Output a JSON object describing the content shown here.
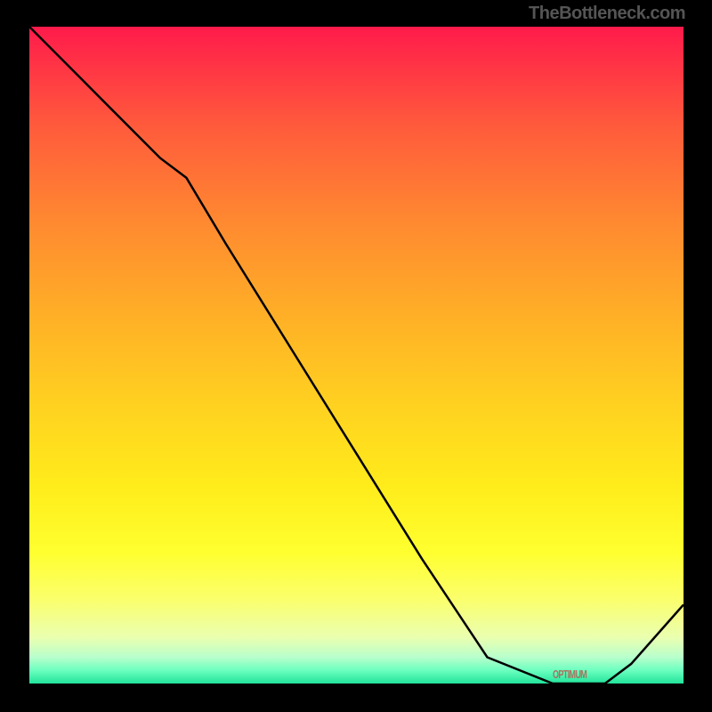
{
  "attribution": "TheBottleneck.com",
  "gradient": {
    "top": "#ff1a4b",
    "bottom": "#22e39a"
  },
  "bottom_marker_label": "OPTIMUM",
  "chart_data": {
    "type": "line",
    "title": "",
    "xlabel": "",
    "ylabel": "",
    "x": [
      0.0,
      0.04,
      0.08,
      0.12,
      0.16,
      0.2,
      0.24,
      0.3,
      0.4,
      0.5,
      0.6,
      0.7,
      0.8,
      0.84,
      0.88,
      0.92,
      1.0
    ],
    "y": [
      1.0,
      0.96,
      0.92,
      0.88,
      0.84,
      0.8,
      0.77,
      0.67,
      0.51,
      0.35,
      0.19,
      0.04,
      0.0,
      0.0,
      0.0,
      0.03,
      0.12
    ],
    "xlim": [
      0,
      1
    ],
    "ylim": [
      0,
      1
    ],
    "line_color": "#000000",
    "line_width": 2,
    "annotations": [
      {
        "x_range": [
          0.8,
          0.88
        ],
        "y": 0.0,
        "text": "OPTIMUM"
      }
    ]
  }
}
